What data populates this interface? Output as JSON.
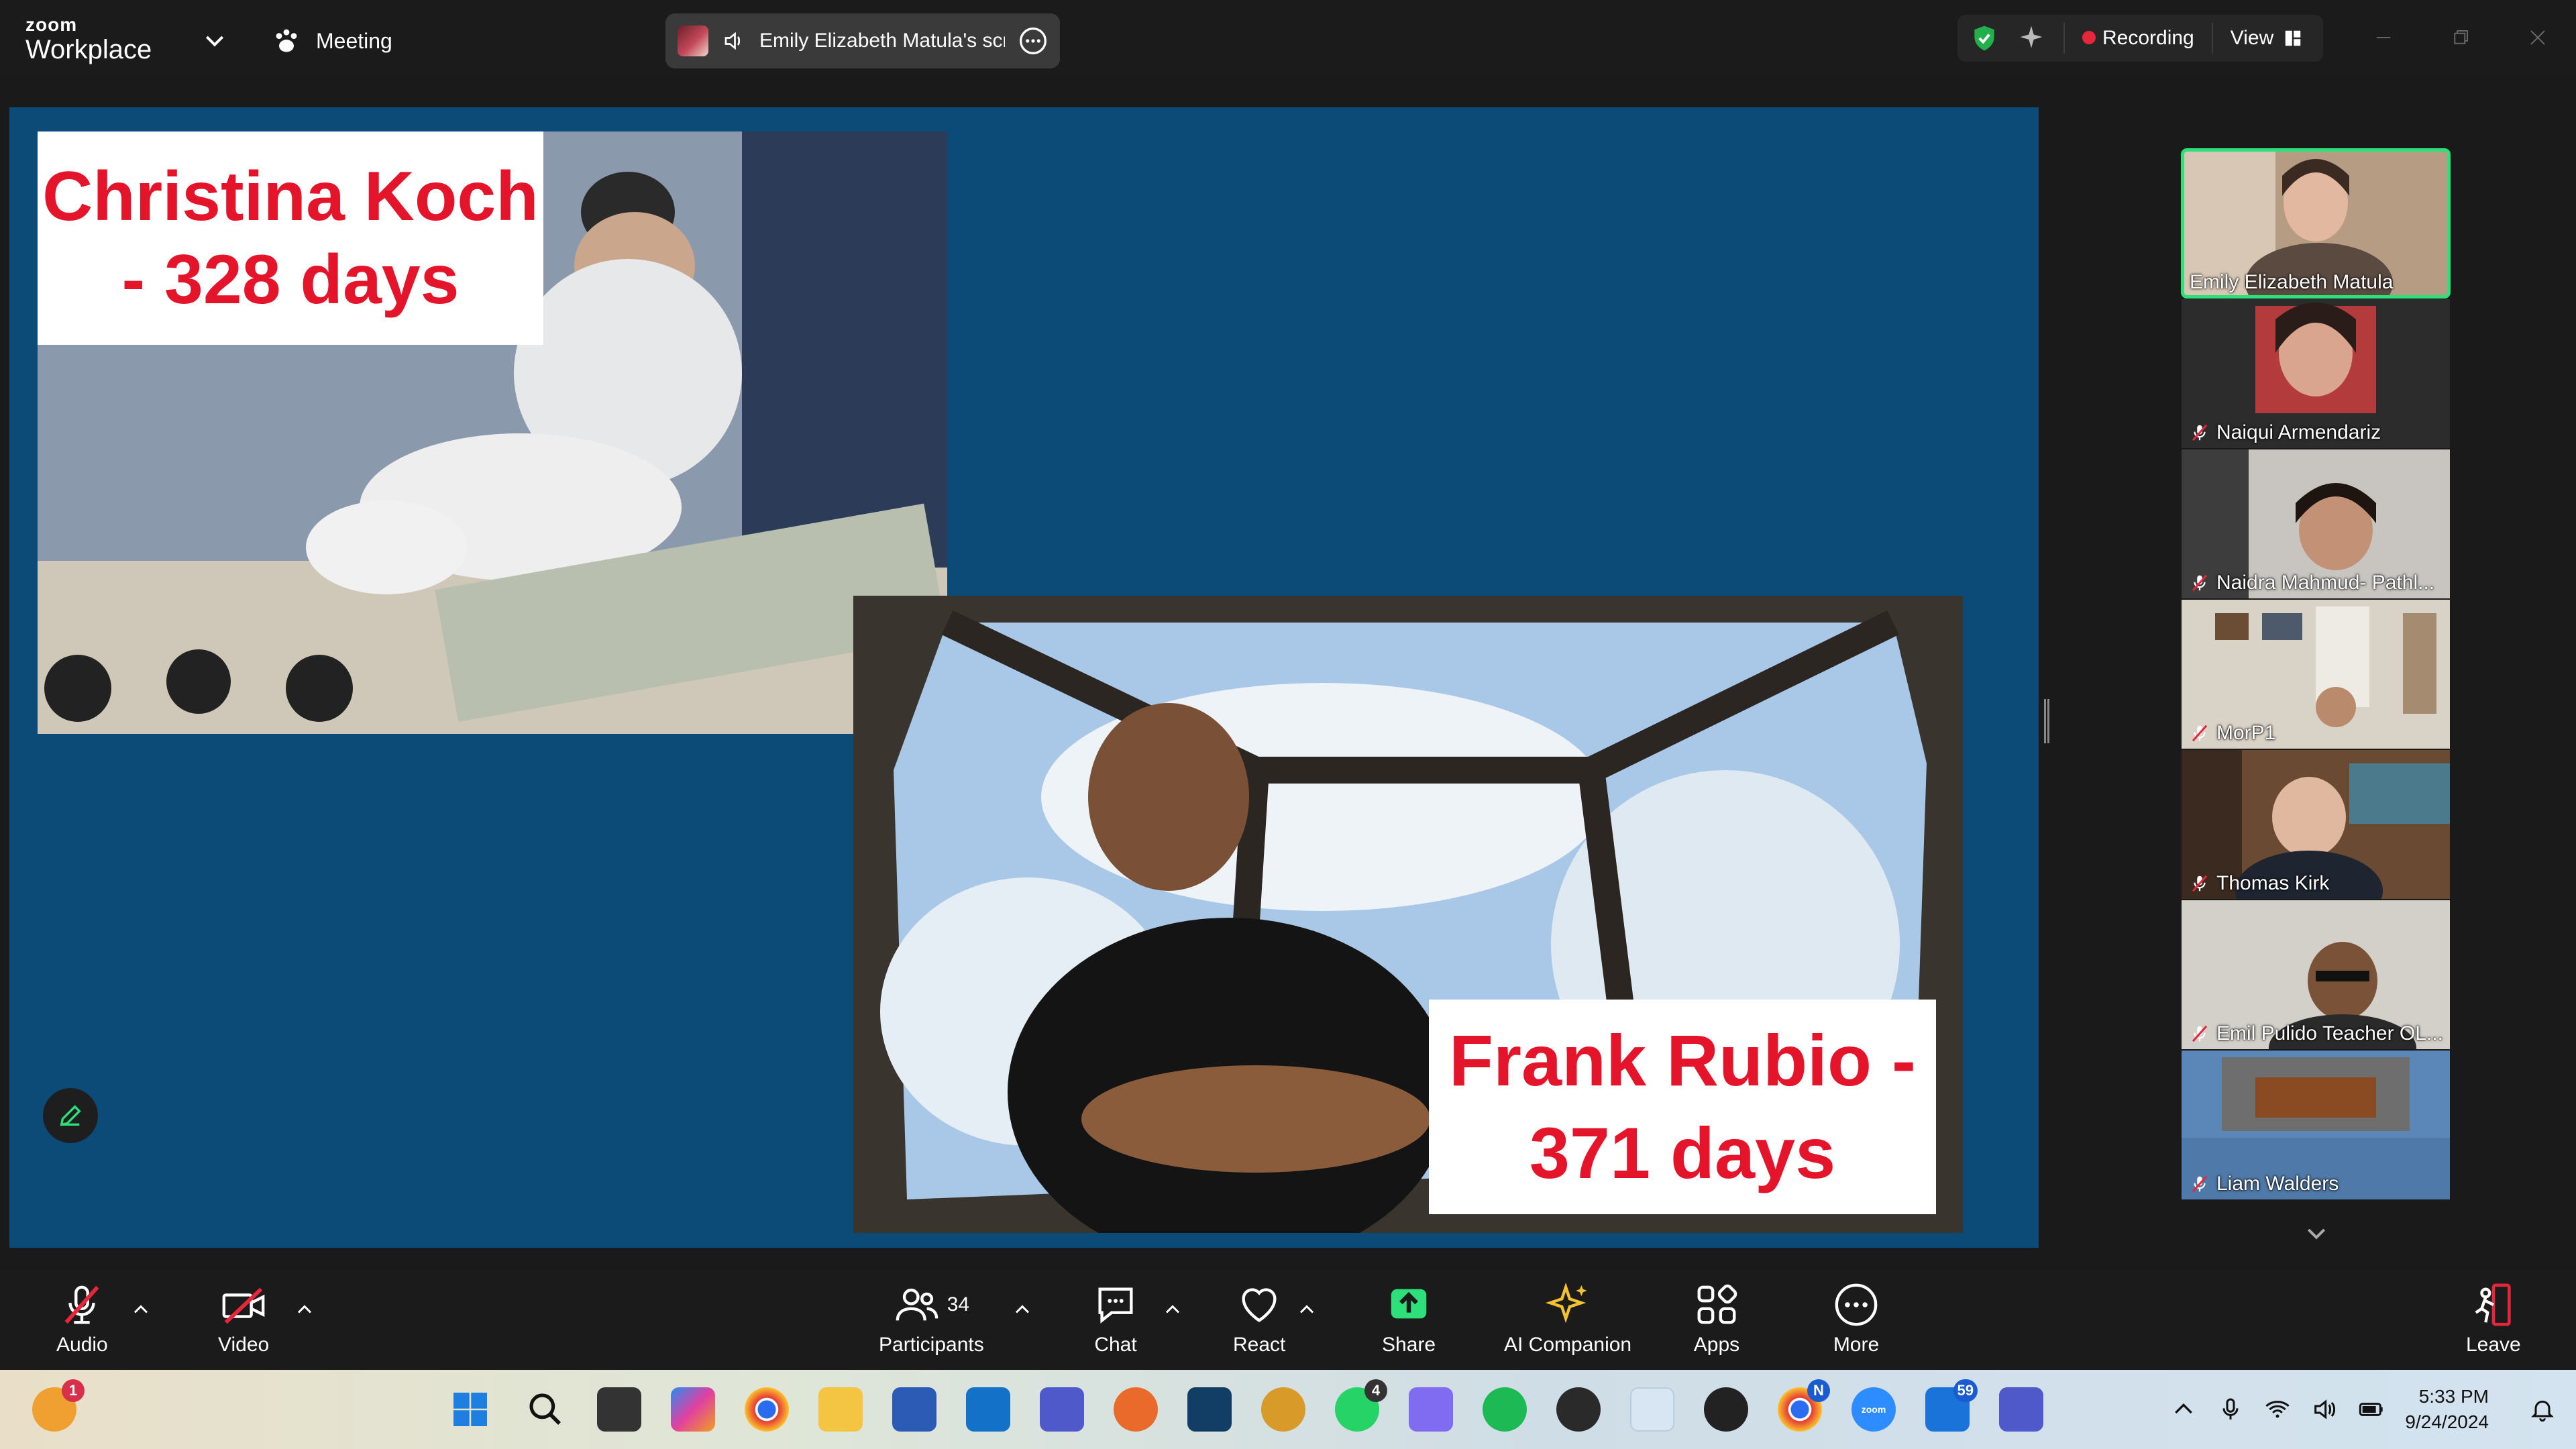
{
  "app": {
    "brand_small": "zoom",
    "brand_big": "Workplace",
    "meeting_label": "Meeting",
    "screen_share_label": "Emily Elizabeth Matula's scre",
    "recording_label": "Recording",
    "view_label": "View"
  },
  "colors": {
    "toolbar_bg": "#1b1b1b",
    "share_bg": "#0c4a78",
    "caption_red": "#e4142a",
    "active_speaker": "#2ee07a",
    "recording_dot": "#e5263b",
    "share_button": "#2ee07a"
  },
  "slide": {
    "caption_koch_line1": "Christina Koch",
    "caption_koch_line2": "- 328 days",
    "caption_rubio_line1": "Frank Rubio -",
    "caption_rubio_line2": "371 days"
  },
  "participants": [
    {
      "name": "Emily Elizabeth Matula",
      "muted": false,
      "active": true
    },
    {
      "name": "Naiqui Armendariz",
      "muted": true,
      "active": false
    },
    {
      "name": "Naidra Mahmud- Pathl...",
      "muted": true,
      "active": false
    },
    {
      "name": "MorP1",
      "muted": true,
      "active": false
    },
    {
      "name": "Thomas Kirk",
      "muted": true,
      "active": false
    },
    {
      "name": "Emil Pulido Teacher OL...",
      "muted": true,
      "active": false
    },
    {
      "name": "Liam Walders",
      "muted": true,
      "active": false
    }
  ],
  "toolbar": {
    "audio": "Audio",
    "video": "Video",
    "participants": "Participants",
    "participants_count": "34",
    "chat": "Chat",
    "react": "React",
    "share": "Share",
    "ai_companion": "AI Companion",
    "apps": "Apps",
    "more": "More",
    "leave": "Leave"
  },
  "taskbar": {
    "notification_badge": "1",
    "whatsapp_badge": "4",
    "chrome_badge": "N",
    "outlook_badge": "59",
    "time": "5:33 PM",
    "date": "9/24/2024",
    "icons": [
      "start-icon",
      "search-icon",
      "task-view-icon",
      "copilot-icon",
      "chrome-icon",
      "file-explorer-icon",
      "store-icon",
      "outlook-icon",
      "teams-icon",
      "app-icon",
      "terminal-icon",
      "app-icon",
      "whatsapp-icon",
      "game-icon",
      "spotify-icon",
      "obs-icon",
      "snipping-tool-icon",
      "app-icon",
      "chrome-profile-icon",
      "zoom-icon",
      "mail-icon",
      "teams-work-icon"
    ]
  }
}
